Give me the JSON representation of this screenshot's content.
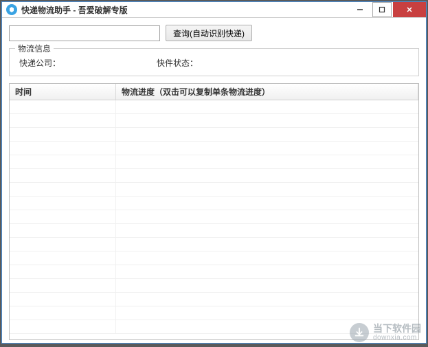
{
  "window": {
    "title": "快递物流助手 - 吾爱破解专版"
  },
  "search": {
    "input_value": "",
    "placeholder": "",
    "button_label": "查询(自动识别快递)"
  },
  "info_group": {
    "legend": "物流信息",
    "company_label": "快递公司：",
    "company_value": "",
    "status_label": "快件状态：",
    "status_value": ""
  },
  "table": {
    "columns": {
      "time": "时间",
      "progress": "物流进度（双击可以复制单条物流进度）"
    },
    "rows": []
  },
  "watermark": {
    "name_cn": "当下软件园",
    "name_en": "downxia.com"
  }
}
